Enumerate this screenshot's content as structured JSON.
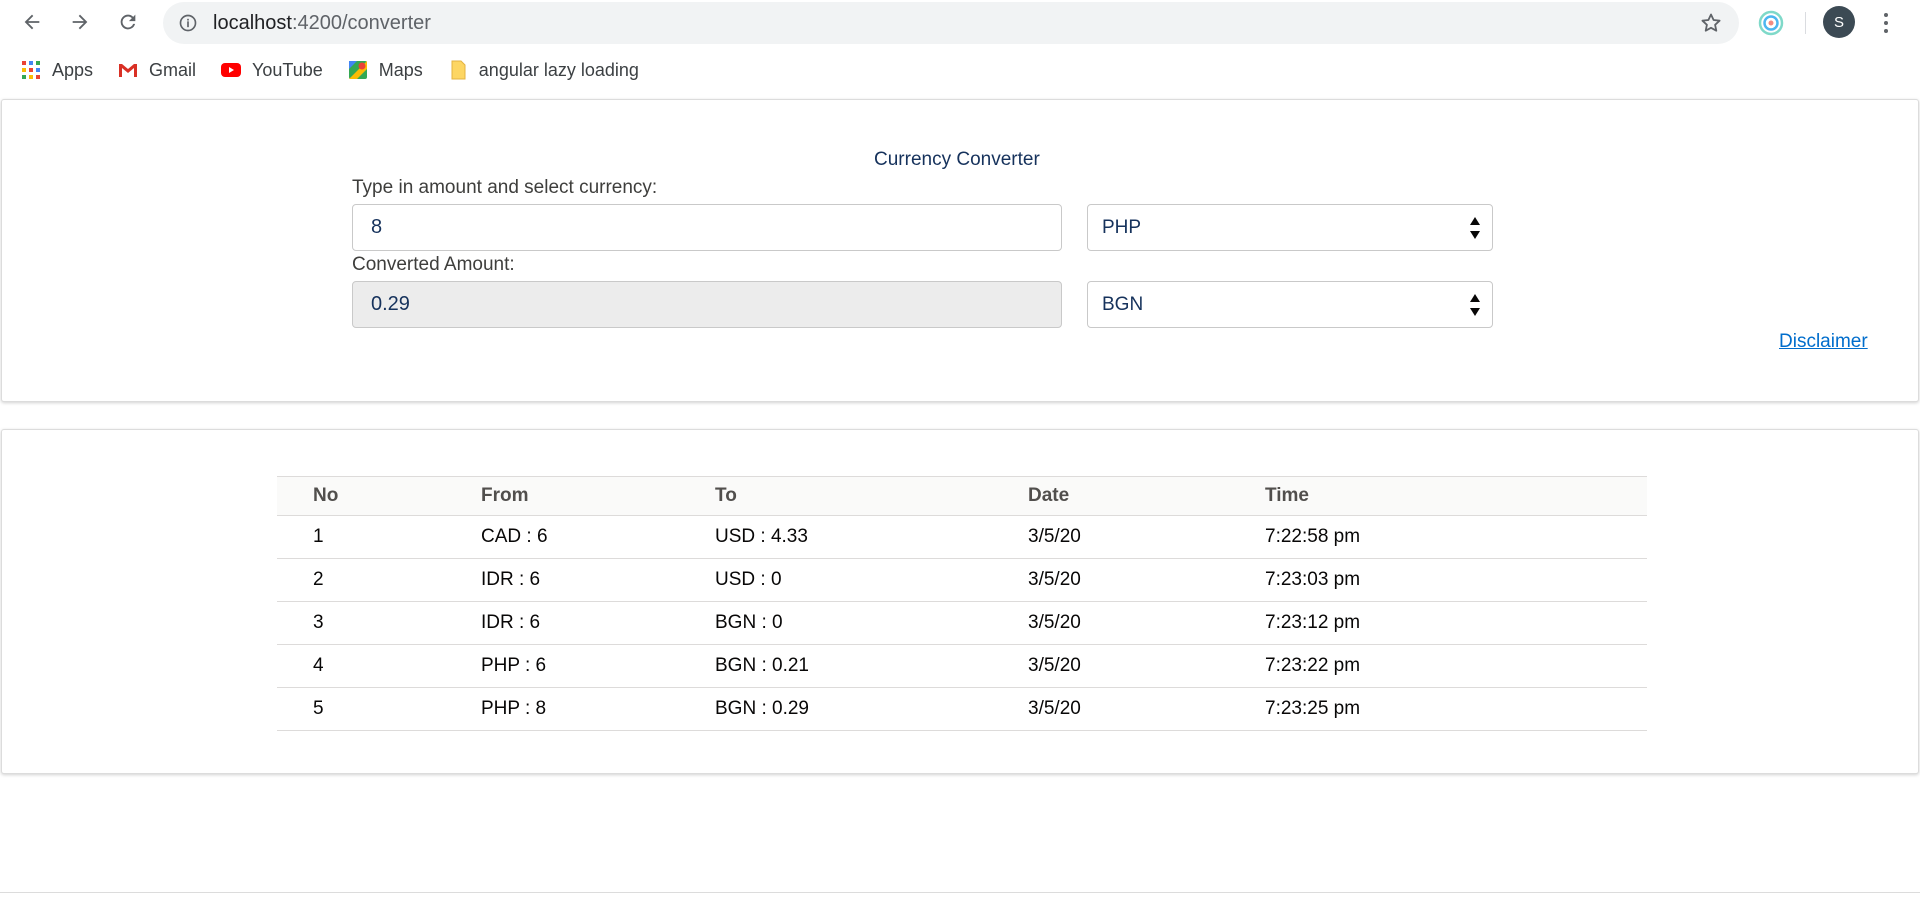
{
  "browser": {
    "url_host": "localhost",
    "url_path": ":4200/converter",
    "profile_initial": "S",
    "bookmarks": [
      {
        "label": "Apps",
        "icon": "apps-grid-icon"
      },
      {
        "label": "Gmail",
        "icon": "gmail-icon"
      },
      {
        "label": "YouTube",
        "icon": "youtube-icon"
      },
      {
        "label": "Maps",
        "icon": "maps-icon"
      },
      {
        "label": "angular lazy loading",
        "icon": "bookmark-folder-icon"
      }
    ]
  },
  "converter": {
    "title": "Currency Converter",
    "amount_label": "Type in amount and select currency:",
    "amount_value": "8",
    "from_currency": "PHP",
    "result_label": "Converted Amount:",
    "result_value": "0.29",
    "to_currency": "BGN",
    "disclaimer_label": "Disclaimer"
  },
  "history": {
    "columns": [
      "No",
      "From",
      "To",
      "Date",
      "Time"
    ],
    "rows": [
      {
        "no": "1",
        "from": "CAD : 6",
        "to": "USD : 4.33",
        "date": "3/5/20",
        "time": "7:22:58 pm"
      },
      {
        "no": "2",
        "from": "IDR : 6",
        "to": "USD : 0",
        "date": "3/5/20",
        "time": "7:23:03 pm"
      },
      {
        "no": "3",
        "from": "IDR : 6",
        "to": "BGN : 0",
        "date": "3/5/20",
        "time": "7:23:12 pm"
      },
      {
        "no": "4",
        "from": "PHP : 6",
        "to": "BGN : 0.21",
        "date": "3/5/20",
        "time": "7:23:22 pm"
      },
      {
        "no": "5",
        "from": "PHP : 8",
        "to": "BGN : 0.29",
        "date": "3/5/20",
        "time": "7:23:25 pm"
      }
    ]
  },
  "colors": {
    "link": "#006dcc",
    "title_text": "#16325c",
    "readonly_bg": "#ececec"
  }
}
